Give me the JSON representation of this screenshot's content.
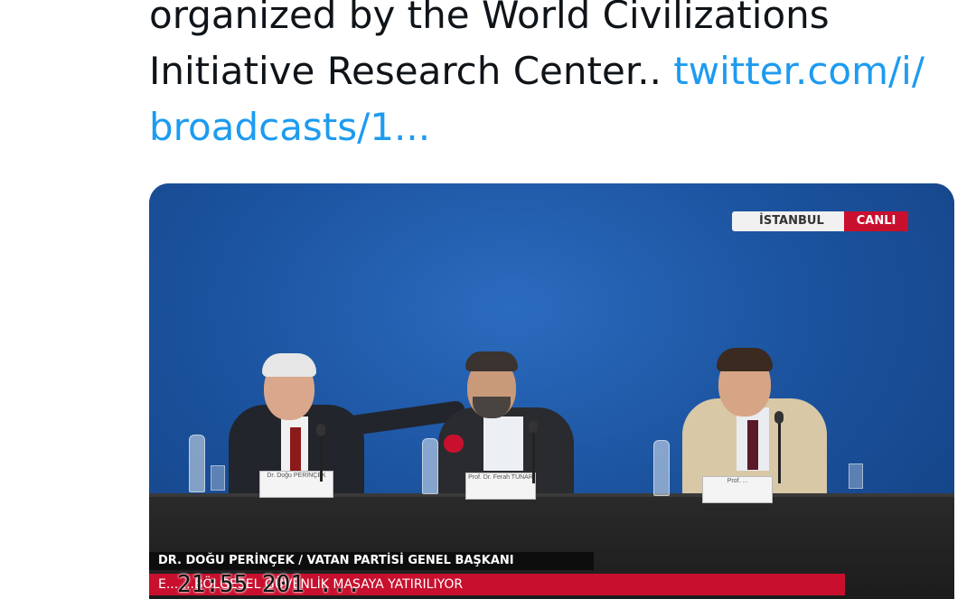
{
  "tweet": {
    "text_line1": "organized by the World Civilizations",
    "text_line2": "Initiative Research Center.. ",
    "link_part1": "twitter.com/i/",
    "link_part2": "broadcasts/1..."
  },
  "video": {
    "location_label": "İSTANBUL",
    "live_label": "CANLI",
    "speaker_caption": "DR. DOĞU PERİNÇEK / VATAN PARTİSİ GENEL BAŞKANI",
    "ticker_text": "E... ...BÖLGESEL GÜVENLİK MASAYA YATIRILIYOR",
    "overlay_time": "21:55  201 ...",
    "nameplates": [
      "Dr. Doğu PERİNÇEK",
      "Prof. Dr. Ferah TUNAR",
      "Prof. ..."
    ]
  },
  "colors": {
    "link": "#1d9bf0",
    "live_badge": "#c8102e",
    "backdrop": "#1c54a0"
  }
}
